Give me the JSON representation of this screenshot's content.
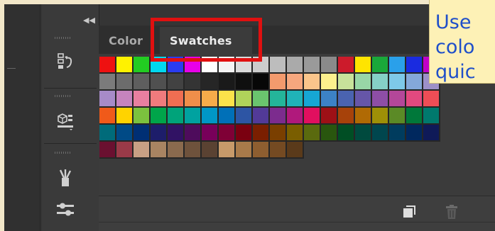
{
  "panel": {
    "tabs": [
      {
        "label": "Color",
        "active": false
      },
      {
        "label": "Swatches",
        "active": true
      }
    ],
    "collapse_icon": "double-chevron-left-icon",
    "highlight_color": "#e01010"
  },
  "tools": [
    {
      "name": "history-icon"
    },
    {
      "name": "3d-cube-icon"
    },
    {
      "name": "brushes-icon"
    },
    {
      "name": "adjustments-icon"
    }
  ],
  "swatches": {
    "rows": [
      [
        "#ee1111",
        "#fff200",
        "#22cc22",
        "#00d8f0",
        "#2a3cf0",
        "#e800e8",
        "#ffffff",
        "#f4f4f4",
        "#dadada",
        "#cccccc",
        "#bdbdbd",
        "#aaaaaa",
        "#9a9a9a",
        "#8a8a8a",
        "#cc1b2b",
        "#ffe400",
        "#1aa83a",
        "#2aa0ea",
        "#1a2be0",
        "#c000c8"
      ],
      [
        "#7b7b7b",
        "#6c6c6c",
        "#5e5e5e",
        "#505050",
        "#424242",
        "#343434",
        "#262626",
        "#1a1a1a",
        "#0f0f0f",
        "#070707",
        "#f39a6d",
        "#f6a77e",
        "#fac58b",
        "#fcf08d",
        "#c8e29a",
        "#98d6a6",
        "#85d0c6",
        "#7ec9e8",
        "#84a8d9",
        "#9d90c8"
      ],
      [
        "#a78bc8",
        "#c684be",
        "#e87fa0",
        "#ef7b7d",
        "#f06e52",
        "#f08e4a",
        "#f6ac4a",
        "#fbe24a",
        "#b0d35a",
        "#6ac46e",
        "#24b59a",
        "#20b3b8",
        "#16a7d4",
        "#3c82c6",
        "#4a63b0",
        "#6656a8",
        "#8d4ea6",
        "#b44799",
        "#e2497f",
        "#ee4d56"
      ],
      [
        "#f05a1a",
        "#ffd300",
        "#7bc23e",
        "#00a54a",
        "#00a37a",
        "#00a2a0",
        "#0097c6",
        "#0070b8",
        "#2d55a4",
        "#523a98",
        "#7c2c8e",
        "#b0197c",
        "#e10f5f",
        "#9e1016",
        "#a7420a",
        "#b06a04",
        "#9e9007",
        "#5b8a26",
        "#00783a",
        "#00796d"
      ],
      [
        "#006b7a",
        "#004a86",
        "#002f74",
        "#1d1d6a",
        "#311264",
        "#4e0c5c",
        "#78005a",
        "#7f0036",
        "#7a0010",
        "#7a1f00",
        "#7a3f00",
        "#7a5e00",
        "#5a6a0e",
        "#29560e",
        "#004e24",
        "#004a3e",
        "#00464e",
        "#003c5e",
        "#00285e",
        "#0f1a58"
      ],
      [
        "#6a1030",
        "#9a3a48",
        "#c8a084",
        "#a88462",
        "#8a6a4e",
        "#6e523c",
        "#5a4232",
        "#c79a6a",
        "#a87a4a",
        "#8e5e30",
        "#744a22",
        "#5a3a1a"
      ]
    ]
  },
  "tooltip": {
    "lines": [
      "Use",
      "colo",
      "quic"
    ],
    "text_color": "#1f4fc9",
    "background": "#fdf1b6"
  },
  "bottom_bar": {
    "new_swatch_icon": "new-swatch-icon",
    "trash_icon": "trash-icon"
  }
}
